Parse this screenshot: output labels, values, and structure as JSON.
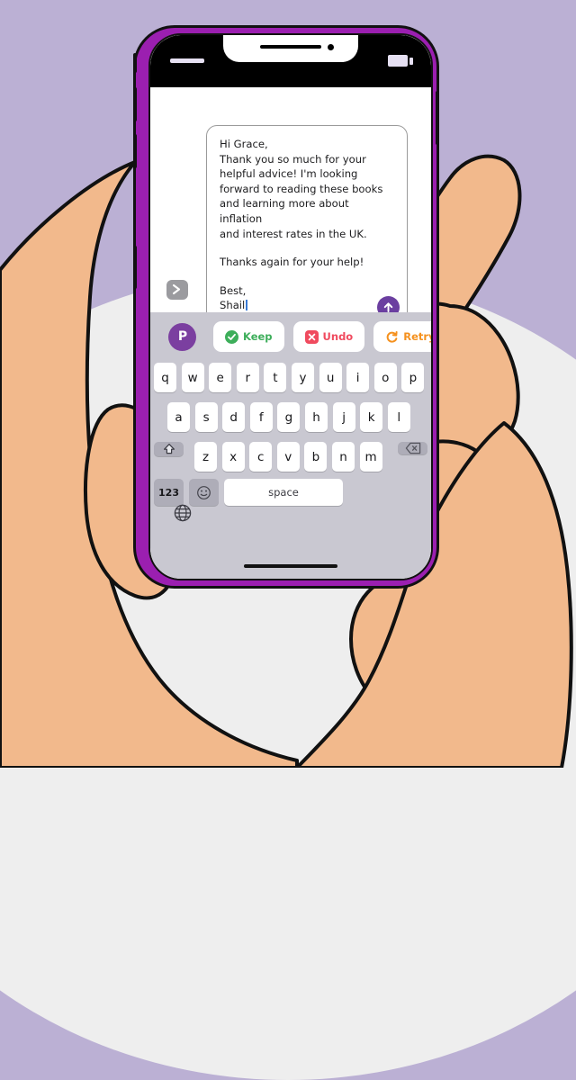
{
  "scene": {
    "description": "Illustration of two hands holding a purple smartphone showing an email composer with AI writing-assistant suggestion bar",
    "background_color": "#bbb0d4",
    "ellipse_color": "#eeeeee",
    "skin_color": "#f2b98c",
    "outline_color": "#111111"
  },
  "phone": {
    "frame_color": "#9b1fb0",
    "screen_color": "#ffffff",
    "status_bar": {
      "signal_icon": "signal-bar-icon",
      "battery_icon": "battery-icon",
      "speaker_icon": "earpiece-speaker-icon",
      "camera_icon": "front-camera-icon"
    }
  },
  "message": {
    "lines": [
      "Hi Grace,",
      "Thank you so much for your",
      "helpful advice! I'm looking",
      "forward to reading these books",
      "and learning more about inflation",
      "and interest rates in the UK."
    ],
    "paragraph2": "Thanks again for your help!",
    "signoff_line1": "Best,",
    "signoff_line2": "Shail",
    "send_icon": "send-arrow-up-icon",
    "send_button_color": "#6b3fa0",
    "expand_icon": "chevron-right-icon"
  },
  "toolbar": {
    "logo_label": "P",
    "logo_color": "#7b3fa0",
    "actions": [
      {
        "label": "Keep",
        "icon": "check-circle-icon",
        "color": "#3dae5a"
      },
      {
        "label": "Undo",
        "icon": "x-square-icon",
        "color": "#f04a5e"
      },
      {
        "label": "Retry",
        "icon": "refresh-circle-icon",
        "color": "#f5911e"
      }
    ]
  },
  "keyboard": {
    "background_color": "#c9c8d1",
    "row1": [
      "q",
      "w",
      "e",
      "r",
      "t",
      "y",
      "u",
      "i",
      "o",
      "p"
    ],
    "row2": [
      "a",
      "s",
      "d",
      "f",
      "g",
      "h",
      "j",
      "k",
      "l"
    ],
    "row3": [
      "z",
      "x",
      "c",
      "v",
      "b",
      "n",
      "m"
    ],
    "shift_icon": "shift-arrow-up-icon",
    "backspace_icon": "backspace-delete-icon",
    "numbers_label": "123",
    "emoji_icon": "smiley-face-icon",
    "space_label": "space",
    "globe_icon": "globe-language-icon",
    "home_indicator": "home-indicator-bar"
  }
}
